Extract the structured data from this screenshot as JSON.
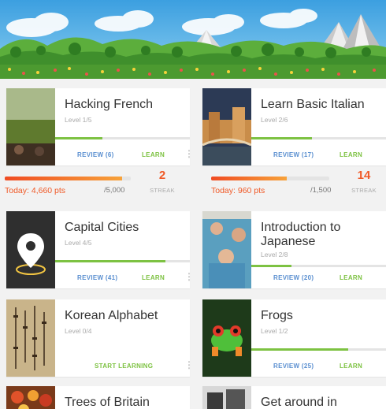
{
  "courses": [
    {
      "title": "Hacking French",
      "level": "Level 1/5",
      "review": "REVIEW (6)",
      "learn": "LEARN",
      "progress": 0.35,
      "thumb": "field-people-photo"
    },
    {
      "title": "Learn Basic Italian",
      "level": "Level 2/6",
      "review": "REVIEW (17)",
      "learn": "LEARN",
      "progress": 0.45,
      "thumb": "venice-bridge-photo"
    },
    {
      "title": "Capital Cities",
      "level": "Level 4/5",
      "review": "REVIEW (41)",
      "learn": "LEARN",
      "progress": 0.82,
      "thumb": "map-pin-icon"
    },
    {
      "title": "Introduction to Japanese",
      "level": "Level 2/8",
      "review": "REVIEW (20)",
      "learn": "LEARN",
      "progress": 0.3,
      "thumb": "festival-crowd-photo"
    },
    {
      "title": "Korean Alphabet",
      "level": "Level 0/4",
      "review": "",
      "learn": "START LEARNING",
      "progress": 0.0,
      "thumb": "calligraphy-photo"
    },
    {
      "title": "Frogs",
      "level": "Level 1/2",
      "review": "REVIEW (25)",
      "learn": "LEARN",
      "progress": 0.72,
      "thumb": "tree-frog-photo"
    },
    {
      "title": "Trees of Britain",
      "thumb": "fruit-photo"
    },
    {
      "title": "Get around in German",
      "thumb": "building-photo"
    }
  ],
  "today": [
    {
      "pts": "Today: 4,660 pts",
      "goal": "/5,000",
      "streak": "2",
      "streak_label": "STREAK",
      "fraction": 0.93
    },
    {
      "pts": "Today: 960 pts",
      "goal": "/1,500",
      "streak": "14",
      "streak_label": "STREAK",
      "fraction": 0.64
    }
  ],
  "more_glyph": "⋮",
  "colors": {
    "accent_orange": "#f05a28",
    "learn_green": "#7dc242",
    "review_blue": "#5a8fd0"
  }
}
